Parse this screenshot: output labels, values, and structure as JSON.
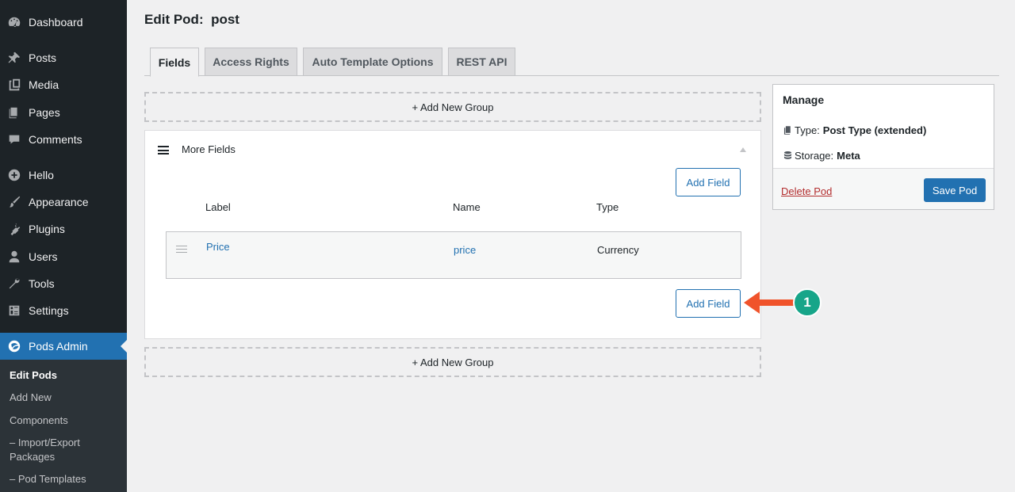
{
  "sidebar": {
    "items": [
      {
        "label": "Dashboard",
        "icon": "dashboard-icon"
      },
      {
        "label": "Posts",
        "icon": "pin-icon"
      },
      {
        "label": "Media",
        "icon": "media-icon"
      },
      {
        "label": "Pages",
        "icon": "pages-icon"
      },
      {
        "label": "Comments",
        "icon": "comment-icon"
      },
      {
        "label": "Hello",
        "icon": "plus-circle-icon"
      },
      {
        "label": "Appearance",
        "icon": "brush-icon"
      },
      {
        "label": "Plugins",
        "icon": "plug-icon"
      },
      {
        "label": "Users",
        "icon": "user-icon"
      },
      {
        "label": "Tools",
        "icon": "wrench-icon"
      },
      {
        "label": "Settings",
        "icon": "settings-icon"
      },
      {
        "label": "Pods Admin",
        "icon": "pods-icon"
      }
    ],
    "submenu": [
      "Edit Pods",
      "Add New",
      "Components",
      "– Import/Export Packages",
      "– Pod Templates"
    ]
  },
  "page": {
    "title_prefix": "Edit Pod:",
    "pod_name": "post"
  },
  "tabs": [
    "Fields",
    "Access Rights",
    "Auto Template Options",
    "REST API"
  ],
  "groups": {
    "add_group_label": "+ Add New Group",
    "group_name": "More Fields",
    "add_field_label": "Add Field",
    "columns": {
      "label": "Label",
      "name": "Name",
      "type": "Type"
    },
    "fields": [
      {
        "label": "Price",
        "name": "price",
        "type": "Currency"
      }
    ]
  },
  "manage": {
    "title": "Manage",
    "type_label": "Type:",
    "type_value": "Post Type (extended)",
    "storage_label": "Storage:",
    "storage_value": "Meta",
    "delete_label": "Delete Pod",
    "save_label": "Save Pod"
  },
  "annotation": {
    "step_number": "1",
    "arrow_color": "#f0532b",
    "badge_color": "#17a589"
  },
  "colors": {
    "accent": "#2271b1",
    "sidebar_bg": "#1d2327",
    "danger": "#b32d2e"
  }
}
